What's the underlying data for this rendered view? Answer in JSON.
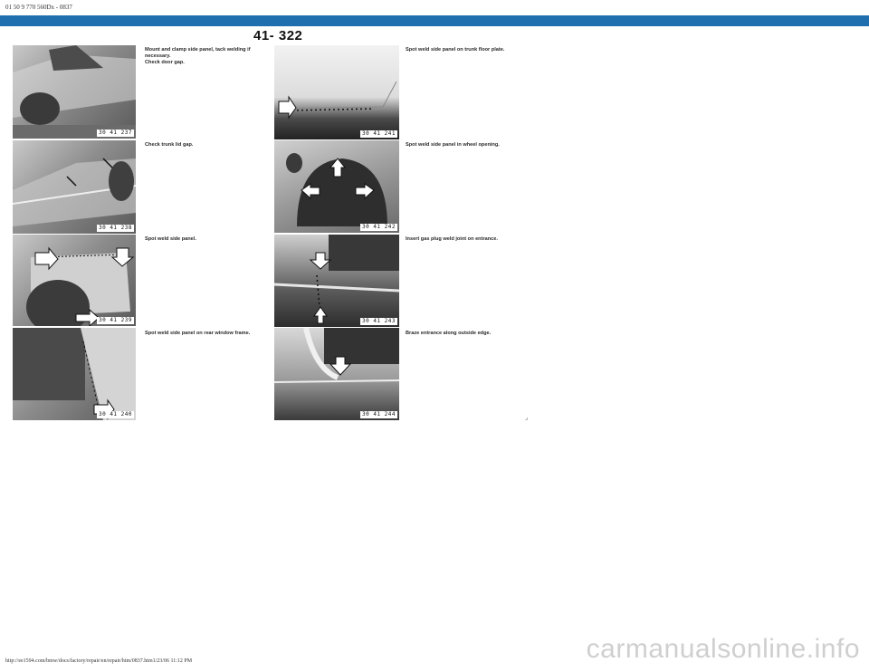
{
  "header": {
    "doc_id": "01 50 9 770 560Dx - 0837"
  },
  "page_number": "41- 322",
  "left_column": [
    {
      "figure": "30 41 237",
      "caption": "Mount and clamp side panel, tack welding if necessary.\nCheck door gap."
    },
    {
      "figure": "30 41 238",
      "caption": "Check trunk lid gap."
    },
    {
      "figure": "30 41 239",
      "caption": "Spot weld side panel."
    },
    {
      "figure": "30 41 240",
      "caption": "Spot weld side panel on rear window frame."
    }
  ],
  "right_column": [
    {
      "figure": "30 41 241",
      "caption": "Spot weld side panel on trunk floor plate."
    },
    {
      "figure": "30 41 242",
      "caption": "Spot weld side panel in wheel opening."
    },
    {
      "figure": "30 41 243",
      "caption": "Insert gas plug weld joint on entrance."
    },
    {
      "figure": "30 41 244",
      "caption": "Braze entrance along outside edge."
    }
  ],
  "footer": {
    "url": "http://ee1594.com/bmw/docs/factory/repair/en/repair/htm/0837.htm1/23/06 11:12 PM"
  },
  "watermark": "carmanualsonline.info"
}
